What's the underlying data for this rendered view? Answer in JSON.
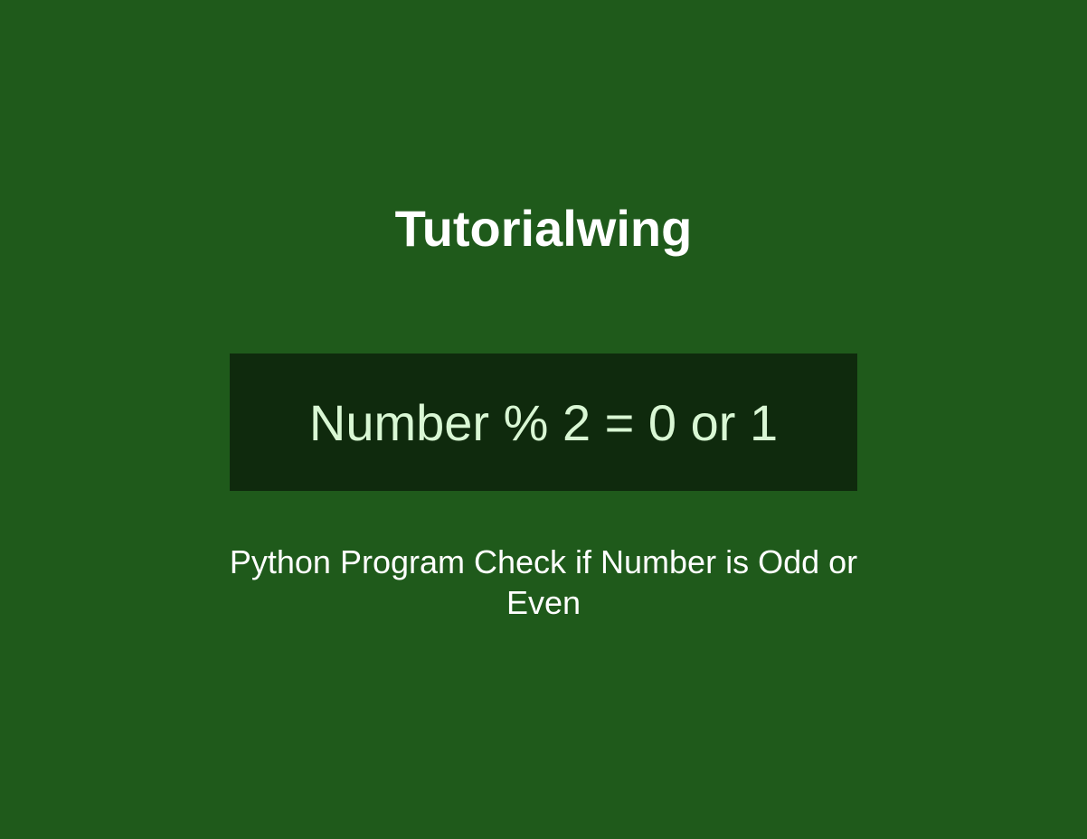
{
  "title": "Tutorialwing",
  "code_box": {
    "text": "Number % 2 = 0 or 1"
  },
  "description": "Python Program Check if Number is Odd or Even"
}
